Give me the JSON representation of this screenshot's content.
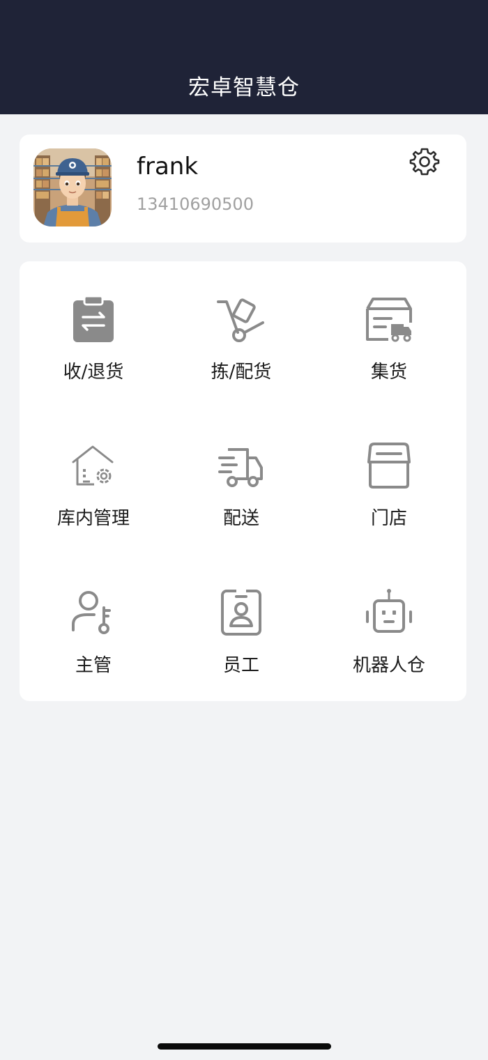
{
  "header": {
    "title": "宏卓智慧仓"
  },
  "profile": {
    "name": "frank",
    "phone": "13410690500",
    "settings_icon": "gear-icon"
  },
  "menu": {
    "items": [
      {
        "label": "收/退货",
        "icon": "clipboard-exchange-icon"
      },
      {
        "label": "拣/配货",
        "icon": "hand-truck-icon"
      },
      {
        "label": "集货",
        "icon": "box-truck-icon"
      },
      {
        "label": "库内管理",
        "icon": "warehouse-settings-icon"
      },
      {
        "label": "配送",
        "icon": "delivery-truck-icon"
      },
      {
        "label": "门店",
        "icon": "store-icon"
      },
      {
        "label": "主管",
        "icon": "user-key-icon"
      },
      {
        "label": "员工",
        "icon": "employee-badge-icon"
      },
      {
        "label": "机器人仓",
        "icon": "robot-icon"
      }
    ]
  },
  "colors": {
    "header_bg": "#1f2337",
    "page_bg": "#f2f3f5",
    "icon_gray": "#8a8a8a"
  }
}
